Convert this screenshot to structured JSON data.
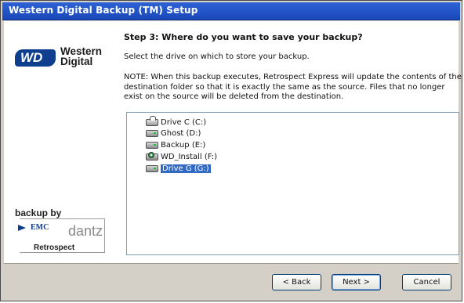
{
  "window": {
    "title": "Western Digital Backup (TM) Setup"
  },
  "sidebar": {
    "logo": {
      "line1": "Western",
      "line2": "Digital"
    },
    "badge": {
      "text": "backup by",
      "emc": "EMC",
      "dantz": "dantz",
      "product": "Retrospect"
    }
  },
  "main": {
    "step_title": "Step 3: Where do you want to save your backup?",
    "instruction": "Select the drive on which to store your backup.",
    "note": "NOTE: When this backup executes, Retrospect Express will update the contents of the destination folder so that it is exactly the same as the source. Files that no longer exist on the source will be deleted from the destination.",
    "drives": [
      {
        "label": "Drive C (C:)",
        "icon": "system-drive-icon",
        "selected": false
      },
      {
        "label": "Ghost (D:)",
        "icon": "hard-drive-icon",
        "selected": false
      },
      {
        "label": "Backup (E:)",
        "icon": "hard-drive-icon",
        "selected": false
      },
      {
        "label": "WD_Install (F:)",
        "icon": "cd-drive-icon",
        "selected": false
      },
      {
        "label": "Drive G (G:)",
        "icon": "hard-drive-icon",
        "selected": true
      }
    ]
  },
  "buttons": {
    "back": "< Back",
    "next": "Next >",
    "cancel": "Cancel"
  },
  "colors": {
    "title_bar": "#1f52c7",
    "selection": "#316ac5",
    "window_bg": "#d4d0c8"
  }
}
